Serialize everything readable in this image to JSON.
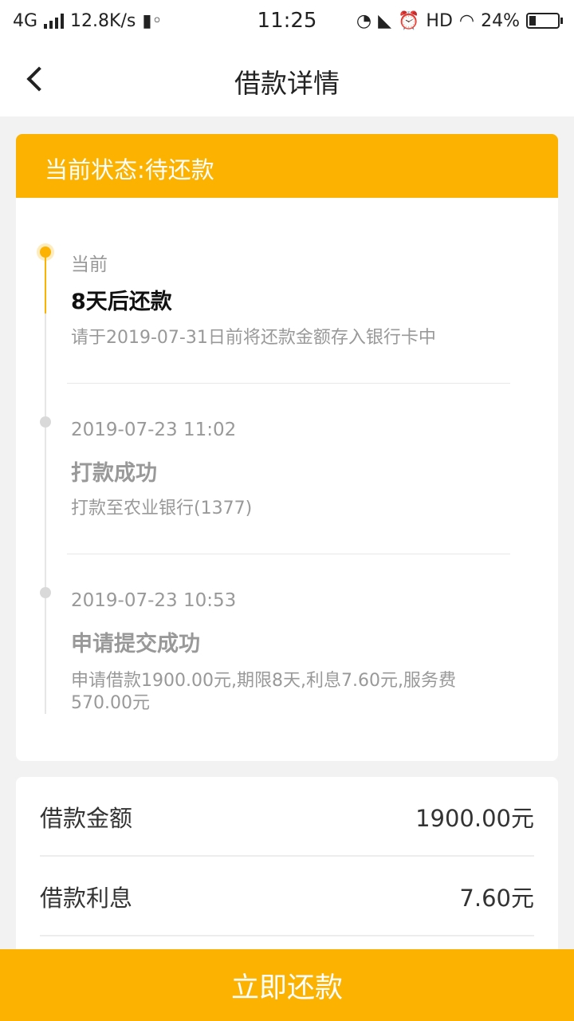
{
  "status_bar": {
    "network": "4G",
    "speed": "12.8K/s",
    "time": "11:25",
    "hd": "HD",
    "battery": "24%"
  },
  "header": {
    "title": "借款详情"
  },
  "status": {
    "banner": "当前状态:待还款"
  },
  "timeline": [
    {
      "time": "当前",
      "title": "8天后还款",
      "desc": "请于2019-07-31日前将还款金额存入银行卡中"
    },
    {
      "time": "2019-07-23 11:02",
      "title": "打款成功",
      "desc": "打款至农业银行(1377)"
    },
    {
      "time": "2019-07-23 10:53",
      "title": "申请提交成功",
      "desc": "申请借款1900.00元,期限8天,利息7.60元,服务费570.00元"
    }
  ],
  "details": [
    {
      "label": "借款金额",
      "value": "1900.00元"
    },
    {
      "label": "借款利息",
      "value": "7.60元"
    }
  ],
  "action": {
    "repay_label": "立即还款"
  },
  "colors": {
    "accent": "#fbb200"
  }
}
